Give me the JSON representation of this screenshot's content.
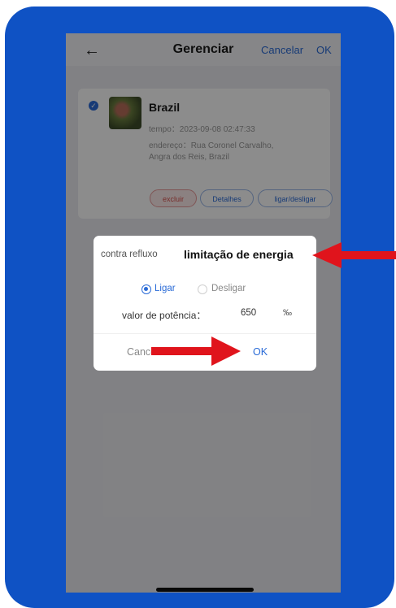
{
  "header": {
    "back_icon": "arrow-left-icon",
    "title": "Gerenciar",
    "cancel_label": "Cancelar",
    "ok_label": "OK"
  },
  "plant": {
    "name": "Brazil",
    "time_label": "tempo：2023-09-08 02:47:33",
    "address_line1": "endereço：Rua Coronel Carvalho,",
    "address_line2": "Angra dos Reis, Brazil",
    "actions": {
      "delete": "excluir",
      "details": "Detalhes",
      "onoff": "ligar/desligar"
    }
  },
  "dialog": {
    "tab_left": "contra refluxo",
    "tab_right": "limitação de energia",
    "radio_on_label": "Ligar",
    "radio_off_label": "Desligar",
    "selected": "Ligar",
    "power_label": "valor de potência：",
    "power_value": "650",
    "power_unit": "‰",
    "cancel_label": "Cancelar",
    "ok_label": "OK"
  },
  "colors": {
    "frame": "#0f52c4",
    "accent": "#2a6bd7",
    "arrow": "#e0141c"
  }
}
